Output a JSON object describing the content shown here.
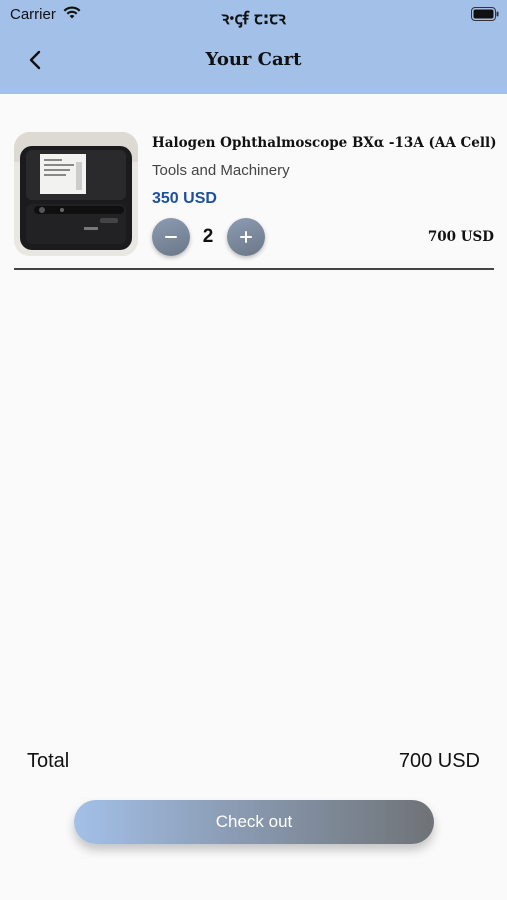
{
  "status_bar": {
    "carrier": "Carrier",
    "clock": "ꝛꞏꞔꞙ ꞇ꞉ꞇꝛ"
  },
  "header": {
    "title": "Your Cart",
    "back_icon": "chevron-left-icon",
    "background": "#a3c0e8"
  },
  "cart": {
    "items": [
      {
        "name": "Halogen Ophthalmoscope BXα -13A (AA Cell)",
        "category": "Tools and Machinery",
        "price": "350 USD",
        "quantity": "2",
        "line_total": "700 USD",
        "minus_icon": "minus-icon",
        "plus_icon": "plus-icon"
      }
    ]
  },
  "summary": {
    "total_label": "Total",
    "total_value": "700 USD"
  },
  "checkout": {
    "label": "Check out"
  },
  "colors": {
    "accent": "#a3c0e8",
    "price": "#1f4f9c"
  }
}
